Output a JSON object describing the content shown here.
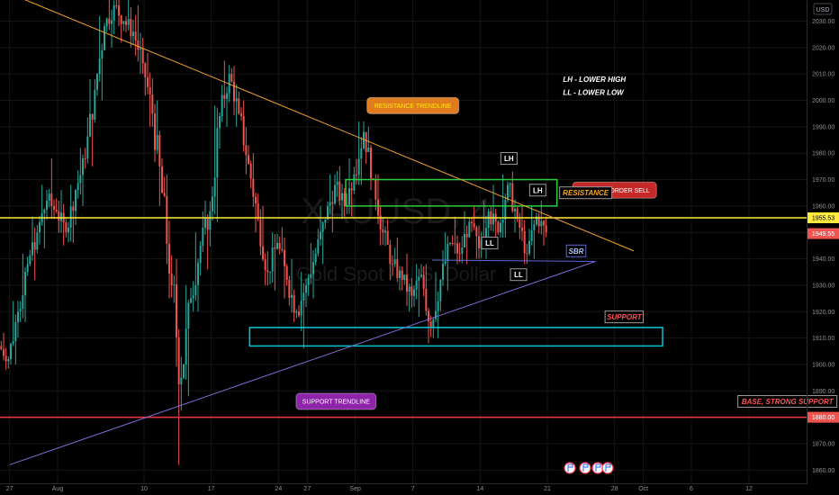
{
  "chart_data": {
    "type": "candlestick",
    "symbol_watermark": "XAUUSD, 4",
    "subtitle_watermark": "Gold Spot / U.S. Dollar",
    "currency": "USD",
    "price_axis": {
      "ylim": [
        1855,
        2038
      ],
      "ticks": [
        1860,
        1870,
        1880,
        1890,
        1900,
        1910,
        1920,
        1930,
        1940,
        1950,
        1960,
        1970,
        1980,
        1990,
        2000,
        2010,
        2020,
        2030
      ],
      "tick_labels": [
        "1860.00",
        "1870.00",
        "1880.00",
        "1890.00",
        "1900.00",
        "1910.00",
        "1920.00",
        "1930.00",
        "1940.00",
        "1950.00",
        "1960.00",
        "1970.00",
        "1980.00",
        "1990.00",
        "2000.00",
        "2010.00",
        "2020.00",
        "2030.00"
      ]
    },
    "time_axis": {
      "xlim": [
        "2023-07-26",
        "2023-10-18"
      ],
      "ticks": [
        {
          "date": "2023-07-27",
          "label": "27"
        },
        {
          "date": "2023-08-01",
          "label": "Aug"
        },
        {
          "date": "2023-08-10",
          "label": "10"
        },
        {
          "date": "2023-08-17",
          "label": "17"
        },
        {
          "date": "2023-08-24",
          "label": "24"
        },
        {
          "date": "2023-08-27",
          "label": "27"
        },
        {
          "date": "2023-09-01",
          "label": "Sep"
        },
        {
          "date": "2023-09-07",
          "label": "7"
        },
        {
          "date": "2023-09-14",
          "label": "14"
        },
        {
          "date": "2023-09-21",
          "label": "21"
        },
        {
          "date": "2023-09-28",
          "label": "28"
        },
        {
          "date": "2023-10-01",
          "label": "Oct"
        },
        {
          "date": "2023-10-06",
          "label": "6"
        },
        {
          "date": "2023-10-12",
          "label": "12"
        }
      ]
    },
    "colors": {
      "up": "#26a69a",
      "down": "#ef5350",
      "background": "#000000"
    },
    "price_tags": [
      {
        "value": 1955.53,
        "label": "1955.53",
        "color": "#ffeb3b",
        "text_color": "#000000"
      },
      {
        "value": 1949.55,
        "label": "1949.55",
        "color": "#ef5350",
        "text_color": "#ffffff"
      },
      {
        "value": 1880.0,
        "label": "1880.00",
        "color": "#ef5350",
        "text_color": "#ffffff"
      }
    ],
    "horizontal_lines": [
      {
        "name": "pending-order-line",
        "y": 1955.53,
        "color": "#ffeb3b"
      },
      {
        "name": "base-support-line",
        "y": 1880,
        "color": "#f23645"
      }
    ],
    "trendlines": [
      {
        "name": "resistance-trendline",
        "from": {
          "x": "2023-07-26",
          "y": 2042
        },
        "to": {
          "x": "2023-09-30",
          "y": 1943
        },
        "color": "#f0a030"
      },
      {
        "name": "support-trendline",
        "from": {
          "x": "2023-07-27",
          "y": 1862
        },
        "to": {
          "x": "2023-09-26",
          "y": 1939
        },
        "color": "#7e6bd4"
      },
      {
        "name": "sbr-line",
        "from": {
          "x": "2023-09-09",
          "y": 1939.5
        },
        "to": {
          "x": "2023-09-26",
          "y": 1939
        },
        "color": "#5b6bd4"
      }
    ],
    "zones": [
      {
        "name": "resistance-zone",
        "x1": "2023-08-31",
        "x2": "2023-09-22",
        "y1": 1960,
        "y2": 1970,
        "color": "#2ecc40"
      },
      {
        "name": "support-zone",
        "x1": "2023-08-21",
        "x2": "2023-10-03",
        "y1": 1907,
        "y2": 1914,
        "color": "#00c8d2"
      }
    ],
    "annotations": [
      {
        "text": "RESISTANCE TRENDLINE",
        "style": "callout",
        "bg": "#e07b1e",
        "color": "#ffee00",
        "x": "2023-09-07",
        "y": 1998
      },
      {
        "text": "SUPPORT TRENDLINE",
        "style": "callout",
        "bg": "#8e24aa",
        "color": "#ffffff",
        "x": "2023-08-30",
        "y": 1886
      },
      {
        "text": "PENDING ORDER SELL",
        "style": "callout",
        "bg": "#c62828",
        "color": "#ffffff",
        "x": "2023-09-28",
        "y": 1966
      },
      {
        "text": "LH - LOWER HIGH",
        "style": "note",
        "color": "#ffffff",
        "x": "2023-09-26",
        "y": 2008
      },
      {
        "text": "LL - LOWER LOW",
        "style": "note",
        "color": "#ffffff",
        "x": "2023-09-26",
        "y": 2003
      },
      {
        "text": "RESISTANCE",
        "style": "tag",
        "color": "#f5a623",
        "x": "2023-09-25",
        "y": 1965
      },
      {
        "text": "SUPPORT",
        "style": "tag",
        "color": "#ff5252",
        "x": "2023-09-29",
        "y": 1918
      },
      {
        "text": "BASE, STRONG SUPPORT",
        "style": "tag",
        "color": "#ff5252",
        "x": "2023-10-16",
        "y": 1886
      },
      {
        "text": "SBR",
        "style": "tag-blue",
        "color": "#a8c6ff",
        "x": "2023-09-24",
        "y": 1943
      },
      {
        "text": "LH",
        "style": "tag-small",
        "color": "#ffffff",
        "x": "2023-09-17",
        "y": 1978
      },
      {
        "text": "LH",
        "style": "tag-small",
        "color": "#ffffff",
        "x": "2023-09-20",
        "y": 1966
      },
      {
        "text": "LL",
        "style": "tag-small",
        "color": "#ffffff",
        "x": "2023-09-15",
        "y": 1946
      },
      {
        "text": "LL",
        "style": "tag-small",
        "color": "#ffffff",
        "x": "2023-09-18",
        "y": 1934
      }
    ],
    "candles": [
      {
        "t": "2023-07-26",
        "o": 1907,
        "h": 1912,
        "l": 1898,
        "c": 1902
      },
      {
        "t": "2023-07-27",
        "o": 1902,
        "h": 1924,
        "l": 1900,
        "c": 1920
      },
      {
        "t": "2023-07-28",
        "o": 1920,
        "h": 1942,
        "l": 1916,
        "c": 1938
      },
      {
        "t": "2023-07-29",
        "o": 1938,
        "h": 1956,
        "l": 1932,
        "c": 1950
      },
      {
        "t": "2023-07-30",
        "o": 1950,
        "h": 1968,
        "l": 1944,
        "c": 1962
      },
      {
        "t": "2023-07-31",
        "o": 1962,
        "h": 1978,
        "l": 1955,
        "c": 1958
      },
      {
        "t": "2023-08-01",
        "o": 1958,
        "h": 1966,
        "l": 1945,
        "c": 1950
      },
      {
        "t": "2023-08-02",
        "o": 1950,
        "h": 1968,
        "l": 1946,
        "c": 1966
      },
      {
        "t": "2023-08-03",
        "o": 1966,
        "h": 1982,
        "l": 1960,
        "c": 1978
      },
      {
        "t": "2023-08-04",
        "o": 1978,
        "h": 2008,
        "l": 1975,
        "c": 2004
      },
      {
        "t": "2023-08-05",
        "o": 2004,
        "h": 2032,
        "l": 2000,
        "c": 2028
      },
      {
        "t": "2023-08-06",
        "o": 2028,
        "h": 2042,
        "l": 2020,
        "c": 2036
      },
      {
        "t": "2023-08-07",
        "o": 2036,
        "h": 2040,
        "l": 2022,
        "c": 2030
      },
      {
        "t": "2023-08-08",
        "o": 2030,
        "h": 2040,
        "l": 2020,
        "c": 2026
      },
      {
        "t": "2023-08-09",
        "o": 2026,
        "h": 2036,
        "l": 2010,
        "c": 2014
      },
      {
        "t": "2023-08-10",
        "o": 2014,
        "h": 2018,
        "l": 1990,
        "c": 1995
      },
      {
        "t": "2023-08-11",
        "o": 1995,
        "h": 2000,
        "l": 1960,
        "c": 1965
      },
      {
        "t": "2023-08-12",
        "o": 1965,
        "h": 1972,
        "l": 1925,
        "c": 1930
      },
      {
        "t": "2023-08-13",
        "o": 1930,
        "h": 1940,
        "l": 1862,
        "c": 1895
      },
      {
        "t": "2023-08-14",
        "o": 1895,
        "h": 1930,
        "l": 1888,
        "c": 1925
      },
      {
        "t": "2023-08-15",
        "o": 1925,
        "h": 1950,
        "l": 1920,
        "c": 1945
      },
      {
        "t": "2023-08-16",
        "o": 1945,
        "h": 1962,
        "l": 1936,
        "c": 1958
      },
      {
        "t": "2023-08-17",
        "o": 1958,
        "h": 1998,
        "l": 1954,
        "c": 1994
      },
      {
        "t": "2023-08-18",
        "o": 1994,
        "h": 2015,
        "l": 1990,
        "c": 2010
      },
      {
        "t": "2023-08-19",
        "o": 2010,
        "h": 2013,
        "l": 1990,
        "c": 1995
      },
      {
        "t": "2023-08-20",
        "o": 1995,
        "h": 2000,
        "l": 1972,
        "c": 1976
      },
      {
        "t": "2023-08-21",
        "o": 1976,
        "h": 1980,
        "l": 1950,
        "c": 1955
      },
      {
        "t": "2023-08-22",
        "o": 1955,
        "h": 1960,
        "l": 1930,
        "c": 1935
      },
      {
        "t": "2023-08-23",
        "o": 1935,
        "h": 1950,
        "l": 1928,
        "c": 1946
      },
      {
        "t": "2023-08-24",
        "o": 1946,
        "h": 1952,
        "l": 1925,
        "c": 1932
      },
      {
        "t": "2023-08-25",
        "o": 1932,
        "h": 1940,
        "l": 1916,
        "c": 1920
      },
      {
        "t": "2023-08-26",
        "o": 1920,
        "h": 1935,
        "l": 1906,
        "c": 1930
      },
      {
        "t": "2023-08-27",
        "o": 1930,
        "h": 1946,
        "l": 1925,
        "c": 1942
      },
      {
        "t": "2023-08-28",
        "o": 1942,
        "h": 1960,
        "l": 1938,
        "c": 1955
      },
      {
        "t": "2023-08-29",
        "o": 1955,
        "h": 1972,
        "l": 1950,
        "c": 1968
      },
      {
        "t": "2023-08-30",
        "o": 1968,
        "h": 1975,
        "l": 1955,
        "c": 1960
      },
      {
        "t": "2023-08-31",
        "o": 1960,
        "h": 1978,
        "l": 1956,
        "c": 1972
      },
      {
        "t": "2023-09-01",
        "o": 1972,
        "h": 1992,
        "l": 1968,
        "c": 1988
      },
      {
        "t": "2023-09-02",
        "o": 1988,
        "h": 1990,
        "l": 1966,
        "c": 1970
      },
      {
        "t": "2023-09-03",
        "o": 1970,
        "h": 1972,
        "l": 1945,
        "c": 1950
      },
      {
        "t": "2023-09-04",
        "o": 1950,
        "h": 1955,
        "l": 1932,
        "c": 1938
      },
      {
        "t": "2023-09-05",
        "o": 1938,
        "h": 1948,
        "l": 1928,
        "c": 1932
      },
      {
        "t": "2023-09-06",
        "o": 1932,
        "h": 1942,
        "l": 1920,
        "c": 1926
      },
      {
        "t": "2023-09-07",
        "o": 1926,
        "h": 1938,
        "l": 1918,
        "c": 1934
      },
      {
        "t": "2023-09-08",
        "o": 1934,
        "h": 1938,
        "l": 1908,
        "c": 1914
      },
      {
        "t": "2023-09-09",
        "o": 1914,
        "h": 1935,
        "l": 1910,
        "c": 1932
      },
      {
        "t": "2023-09-10",
        "o": 1932,
        "h": 1950,
        "l": 1928,
        "c": 1946
      },
      {
        "t": "2023-09-11",
        "o": 1946,
        "h": 1956,
        "l": 1938,
        "c": 1942
      },
      {
        "t": "2023-09-12",
        "o": 1942,
        "h": 1958,
        "l": 1938,
        "c": 1954
      },
      {
        "t": "2023-09-13",
        "o": 1954,
        "h": 1960,
        "l": 1940,
        "c": 1944
      },
      {
        "t": "2023-09-14",
        "o": 1944,
        "h": 1962,
        "l": 1940,
        "c": 1958
      },
      {
        "t": "2023-09-15",
        "o": 1958,
        "h": 1968,
        "l": 1946,
        "c": 1950
      },
      {
        "t": "2023-09-16",
        "o": 1950,
        "h": 1972,
        "l": 1948,
        "c": 1968
      },
      {
        "t": "2023-09-17",
        "o": 1968,
        "h": 1973,
        "l": 1950,
        "c": 1955
      },
      {
        "t": "2023-09-18",
        "o": 1955,
        "h": 1960,
        "l": 1938,
        "c": 1942
      },
      {
        "t": "2023-09-19",
        "o": 1942,
        "h": 1960,
        "l": 1940,
        "c": 1956
      },
      {
        "t": "2023-09-20",
        "o": 1956,
        "h": 1962,
        "l": 1945,
        "c": 1950
      }
    ]
  }
}
